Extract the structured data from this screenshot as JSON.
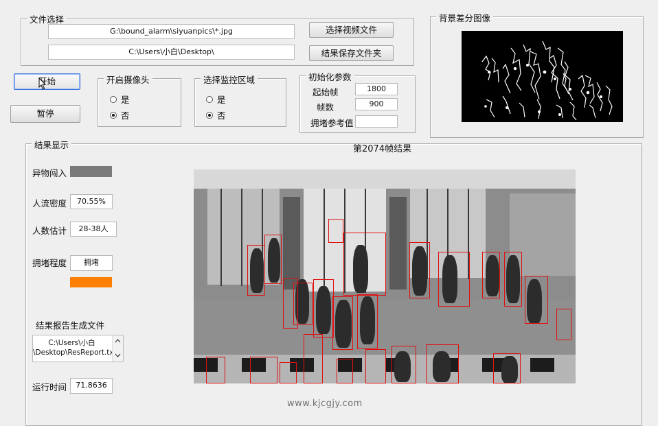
{
  "file_select": {
    "legend": "文件选择",
    "video_path": "G:\\bound_alarm\\siyuanpics\\*.jpg",
    "save_path": "C:\\Users\\小白\\Desktop\\",
    "choose_video_btn": "选择视频文件",
    "save_folder_btn": "结果保存文件夹"
  },
  "controls": {
    "start_btn": "开始",
    "pause_btn": "暂停"
  },
  "camera": {
    "legend": "开启摄像头",
    "yes": "是",
    "no": "否",
    "selected": "no"
  },
  "region": {
    "legend": "选择监控区域",
    "yes": "是",
    "no": "否",
    "selected": "no"
  },
  "init_params": {
    "legend": "初始化参数",
    "start_frame_label": "起始帧",
    "start_frame": "1800",
    "frame_count_label": "帧数",
    "frame_count": "900",
    "congestion_ref_label": "拥堵参考值",
    "congestion_ref": ""
  },
  "bg_diff": {
    "legend": "背景差分图像"
  },
  "results": {
    "legend": "结果显示",
    "frame_title": "第2074帧结果",
    "intrusion_label": "异物闯入",
    "intrusion_color": "#7a7a7a",
    "density_label": "人流密度",
    "density_value": "70.55%",
    "count_label": "人数估计",
    "count_value": "28-38人",
    "crowd_label": "拥堵程度",
    "crowd_value": "拥堵",
    "crowd_color": "#ff8000",
    "report_label": "结果报告生成文件",
    "report_line1": "C:\\Users\\小白",
    "report_line2": "\\Desktop\\ResReport.txt",
    "runtime_label": "运行时间",
    "runtime_value": "71.8636"
  },
  "watermark": "www.kjcgjy.com",
  "icons": {
    "scroll_up": "chevron-up-icon",
    "scroll_down": "chevron-down-icon",
    "cursor": "mouse-pointer-icon"
  }
}
